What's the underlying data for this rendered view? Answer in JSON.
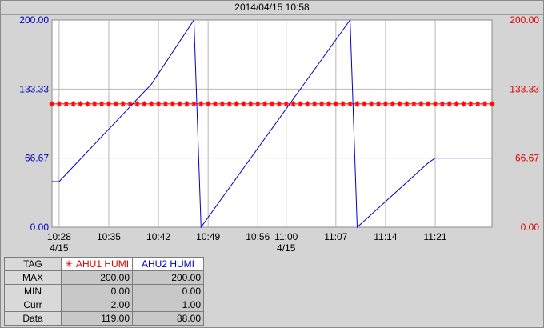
{
  "window": {
    "title": "2014/04/15 10:58"
  },
  "colors": {
    "series1": "#ff0000",
    "series2": "#0000cc",
    "grid": "#b8b8b8",
    "plot_bg": "#ffffff"
  },
  "chart_data": {
    "type": "line",
    "y_left": {
      "ticks": [
        "200.00",
        "133.33",
        "66.67",
        "0.00"
      ],
      "ylim": [
        0,
        200
      ]
    },
    "y_right": {
      "ticks": [
        "200.00",
        "133.33",
        "66.67",
        "0.00"
      ],
      "ylim": [
        0,
        200
      ]
    },
    "x_ticks": [
      {
        "time": "10:28",
        "date": "4/15"
      },
      {
        "time": "10:35",
        "date": ""
      },
      {
        "time": "10:42",
        "date": ""
      },
      {
        "time": "10:49",
        "date": ""
      },
      {
        "time": "10:56",
        "date": ""
      },
      {
        "time": "11:00",
        "date": "4/15"
      },
      {
        "time": "11:07",
        "date": ""
      },
      {
        "time": "11:14",
        "date": ""
      },
      {
        "time": "11:21",
        "date": ""
      }
    ],
    "xlim": [
      "10:27",
      "11:29"
    ],
    "grid": true,
    "series": [
      {
        "name": "AHU1 HUMI",
        "marker": "asterisk",
        "x": [
          "10:27",
          "10:28",
          "10:29",
          "10:30",
          "10:31",
          "10:32",
          "10:33",
          "10:34",
          "10:35",
          "10:36",
          "10:37",
          "10:38",
          "10:39",
          "10:40",
          "10:41",
          "10:42",
          "10:43",
          "10:44",
          "10:45",
          "10:46",
          "10:47",
          "10:48",
          "10:49",
          "10:50",
          "10:51",
          "10:52",
          "10:53",
          "10:54",
          "10:55",
          "10:56",
          "10:57",
          "10:58",
          "10:59",
          "11:00",
          "11:01",
          "11:02",
          "11:03",
          "11:04",
          "11:05",
          "11:06",
          "11:07",
          "11:08",
          "11:09",
          "11:10",
          "11:11",
          "11:12",
          "11:13",
          "11:14",
          "11:15",
          "11:16",
          "11:17",
          "11:18",
          "11:19",
          "11:20",
          "11:21",
          "11:22",
          "11:23",
          "11:24",
          "11:25",
          "11:26",
          "11:27",
          "11:28",
          "11:29"
        ],
        "y": [
          119,
          119,
          119,
          119,
          119,
          119,
          119,
          119,
          119,
          119,
          119,
          119,
          119,
          119,
          119,
          119,
          119,
          119,
          119,
          119,
          119,
          119,
          119,
          119,
          119,
          119,
          119,
          119,
          119,
          119,
          119,
          119,
          119,
          119,
          119,
          119,
          119,
          119,
          119,
          119,
          119,
          119,
          119,
          119,
          119,
          119,
          119,
          119,
          119,
          119,
          119,
          119,
          119,
          119,
          119,
          119,
          119,
          119,
          119,
          119,
          119,
          119,
          119
        ]
      },
      {
        "name": "AHU2 HUMI",
        "marker": "none",
        "x": [
          "10:27",
          "10:28",
          "10:41",
          "10:47",
          "10:48",
          "11:09",
          "11:10",
          "11:20",
          "11:21",
          "11:29"
        ],
        "y": [
          44,
          44,
          138,
          200,
          0,
          200,
          0,
          62,
          66.7,
          66.7
        ]
      }
    ]
  },
  "stats_table": {
    "header": {
      "tag": "TAG",
      "s1": "AHU1 HUMI",
      "s2": "AHU2 HUMI"
    },
    "rows": [
      {
        "label": "MAX",
        "v1": "200.00",
        "v2": "200.00"
      },
      {
        "label": "MIN",
        "v1": "0.00",
        "v2": "0.00"
      },
      {
        "label": "Curr",
        "v1": "2.00",
        "v2": "1.00"
      },
      {
        "label": "Data",
        "v1": "119.00",
        "v2": "88.00"
      }
    ]
  }
}
